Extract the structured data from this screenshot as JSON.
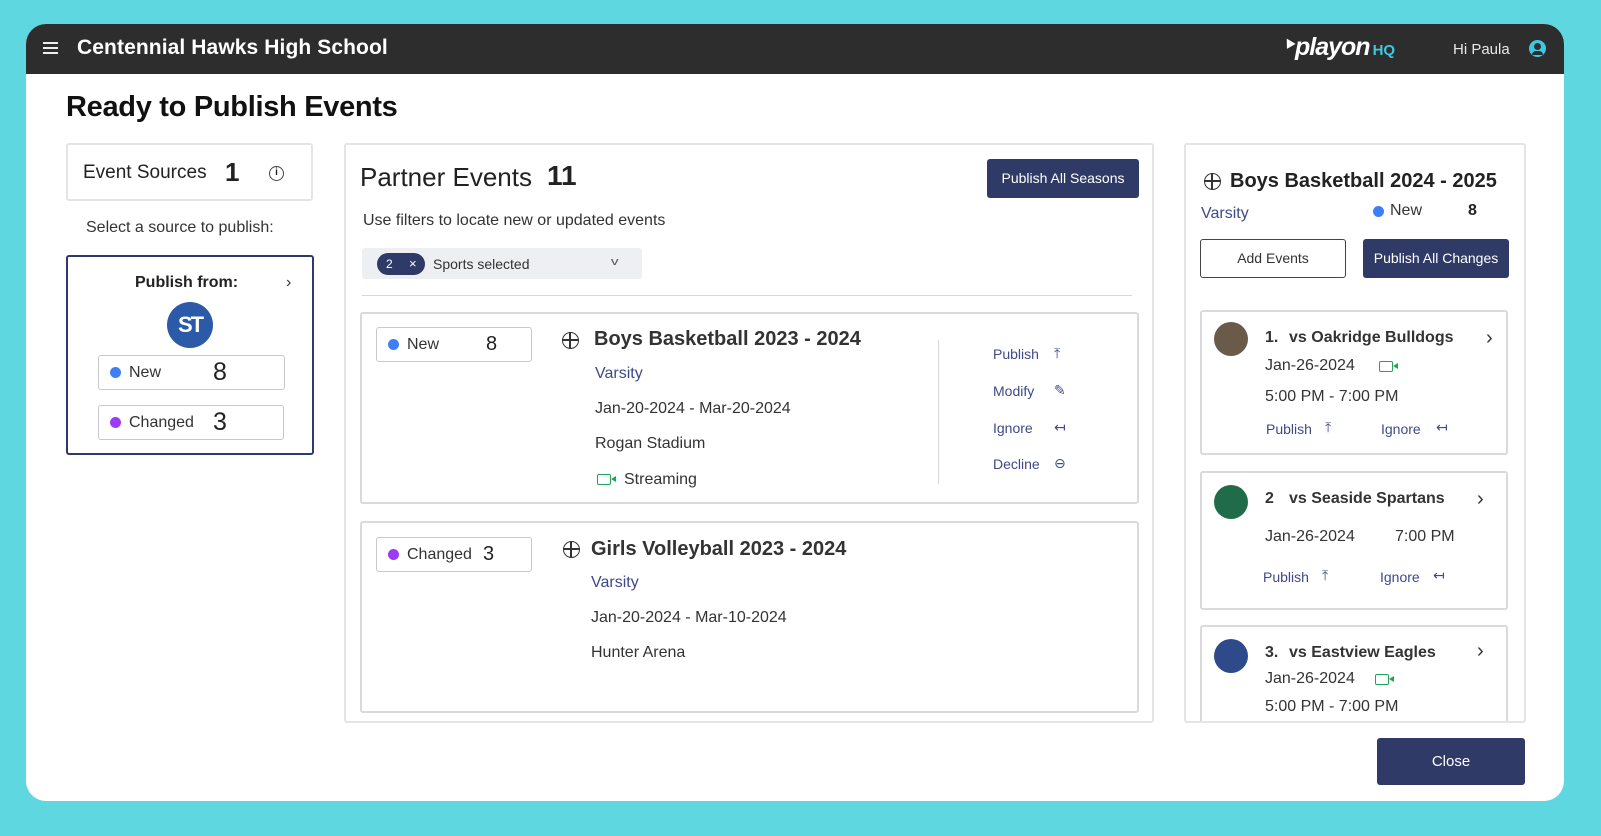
{
  "header": {
    "school_name": "Centennial Hawks High School",
    "brand_name": "playon",
    "brand_suffix": "HQ",
    "greeting": "Hi Paula",
    "accent_color": "#3ec7e0"
  },
  "page": {
    "title": "Ready to Publish Events"
  },
  "sources": {
    "label": "Event Sources",
    "count": "1",
    "info_icon": "info-icon",
    "select_prompt": "Select a source to publish:",
    "publish_from_label": "Publish from:",
    "source_logo_text": "ST",
    "new_label": "New",
    "new_count": "8",
    "changed_label": "Changed",
    "changed_count": "3"
  },
  "partner": {
    "title": "Partner Events",
    "count": "11",
    "publish_all_label": "Publish All Seasons",
    "filters_hint": "Use filters to locate new or updated events",
    "filter": {
      "chip_count": "2",
      "chip_remove": "×",
      "label": "Sports selected"
    },
    "events": [
      {
        "status_label": "New",
        "status_count": "8",
        "title": "Boys Basketball 2023 - 2024",
        "level": "Varsity",
        "dates": "Jan-20-2024 - Mar-20-2024",
        "venue": "Rogan Stadium",
        "streaming": "Streaming",
        "actions": [
          {
            "label": "Publish",
            "glyph": "⤒"
          },
          {
            "label": "Modify",
            "glyph": "✎"
          },
          {
            "label": "Ignore",
            "glyph": "↤"
          },
          {
            "label": "Decline",
            "glyph": "⊖"
          }
        ]
      },
      {
        "status_label": "Changed",
        "status_count": "3",
        "title": "Girls Volleyball 2023 - 2024",
        "level": "Varsity",
        "dates": "Jan-20-2024 - Mar-10-2024",
        "venue": "Hunter Arena"
      }
    ]
  },
  "season": {
    "title": "Boys Basketball 2024 - 2025",
    "level": "Varsity",
    "new_label": "New",
    "new_count": "8",
    "add_events_label": "Add Events",
    "publish_changes_label": "Publish All Changes",
    "games": [
      {
        "number": "1.",
        "opponent": "vs Oakridge Bulldogs",
        "date": "Jan-26-2024",
        "time": "5:00 PM - 7:00 PM",
        "publish_label": "Publish",
        "ignore_label": "Ignore",
        "logo_color": "#6a5a4a"
      },
      {
        "number": "2",
        "opponent": "vs Seaside Spartans",
        "date": "Jan-26-2024",
        "time": "7:00 PM",
        "publish_label": "Publish",
        "ignore_label": "Ignore",
        "logo_color": "#1f6b4a"
      },
      {
        "number": "3.",
        "opponent": "vs Eastview Eagles",
        "date": "Jan-26-2024",
        "time": "5:00 PM - 7:00 PM",
        "logo_color": "#2f4a8a"
      }
    ]
  },
  "footer": {
    "close_label": "Close"
  }
}
